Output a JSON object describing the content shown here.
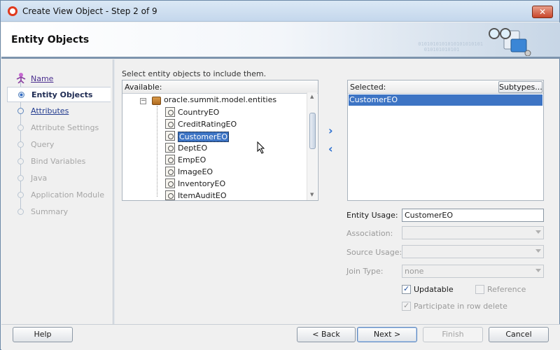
{
  "window": {
    "title": "Create View Object - Step 2 of 9",
    "close_glyph": "✕"
  },
  "header": {
    "title": "Entity Objects",
    "binary_text": "0101010101010101010101\n  010101010101"
  },
  "nav": {
    "items": [
      {
        "label": "Name",
        "state": "done"
      },
      {
        "label": "Entity Objects",
        "state": "current"
      },
      {
        "label": "Attributes",
        "state": "link"
      },
      {
        "label": "Attribute Settings",
        "state": "disabled"
      },
      {
        "label": "Query",
        "state": "disabled"
      },
      {
        "label": "Bind Variables",
        "state": "disabled"
      },
      {
        "label": "Java",
        "state": "disabled"
      },
      {
        "label": "Application Module",
        "state": "disabled"
      },
      {
        "label": "Summary",
        "state": "disabled"
      }
    ]
  },
  "main": {
    "instruction": "Select entity objects to include them.",
    "available": {
      "label": "Available:",
      "package": "oracle.summit.model.entities",
      "entities": [
        "CountryEO",
        "CreditRatingEO",
        "CustomerEO",
        "DeptEO",
        "EmpEO",
        "ImageEO",
        "InventoryEO",
        "ItemAuditEO"
      ],
      "highlighted": "CustomerEO"
    },
    "shuttle": {
      "add": "›",
      "remove": "‹"
    },
    "selected": {
      "label": "Selected:",
      "subtypes_button": "Subtypes...",
      "items": [
        "CustomerEO"
      ]
    },
    "form": {
      "entity_usage_label": "Entity Usage:",
      "entity_usage_value": "CustomerEO",
      "association_label": "Association:",
      "association_value": "",
      "source_usage_label": "Source Usage:",
      "source_usage_value": "",
      "join_type_label": "Join Type:",
      "join_type_value": "none",
      "updatable_label": "Updatable",
      "updatable_checked": true,
      "reference_label": "Reference",
      "reference_checked": false,
      "participate_label": "Participate in row delete",
      "participate_checked": true
    }
  },
  "footer": {
    "help": "Help",
    "back": "< Back",
    "next": "Next >",
    "finish": "Finish",
    "cancel": "Cancel"
  },
  "colors": {
    "selection": "#3d74c4",
    "accent": "#2a6ecf",
    "header_rule": "#7d94ad"
  }
}
